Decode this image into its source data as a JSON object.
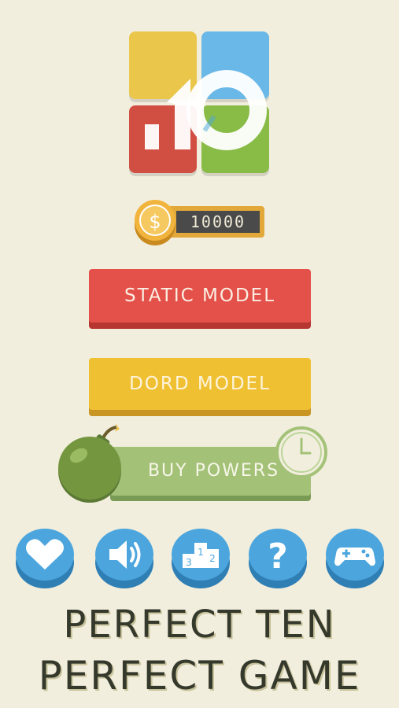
{
  "logo": {
    "text": "10",
    "colors": {
      "yellow": "#eac64a",
      "blue": "#6ab8e8",
      "red": "#d14e42",
      "green": "#89bb47"
    }
  },
  "coins": {
    "value": "10000",
    "symbol": "$",
    "coin_color": "#f1b43d"
  },
  "buttons": {
    "static_model": "STATIC MODEL",
    "dord_model": "DORD MODEL",
    "buy_powers": "BUY POWERS"
  },
  "icons": [
    "bomb-icon",
    "clock-icon",
    "heart-icon",
    "sound-icon",
    "leaderboard-icon",
    "help-icon",
    "gamepad-icon"
  ],
  "leaderboard_ranks": [
    "3",
    "1",
    "2"
  ],
  "help_symbol": "?",
  "footer": {
    "line1": "PERFECT TEN",
    "line2": "PERFECT GAME"
  },
  "accent": {
    "red": "#e4504a",
    "yellow": "#f0c033",
    "green": "#a3c278",
    "blue": "#4ca6dd"
  }
}
